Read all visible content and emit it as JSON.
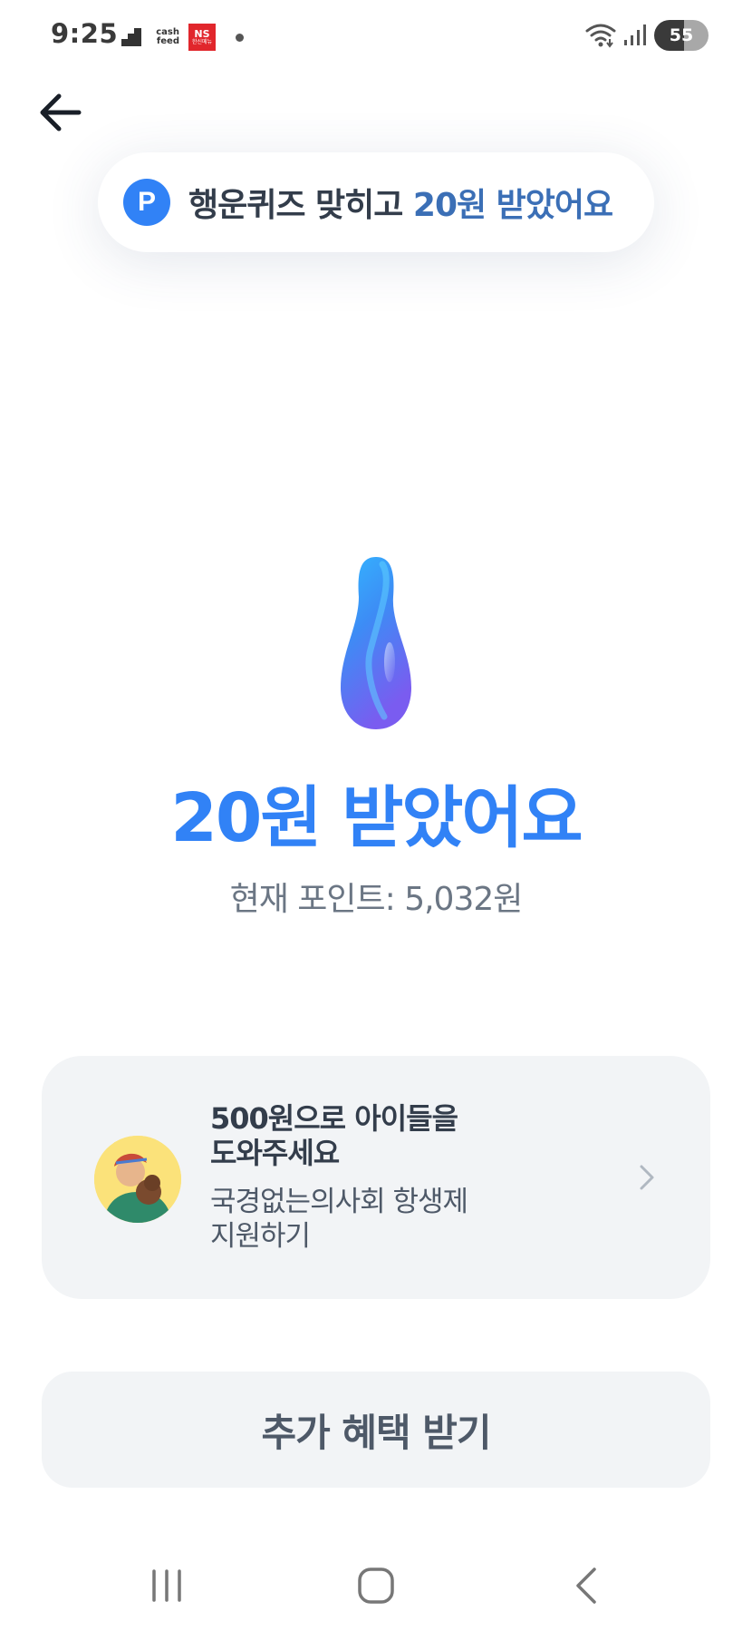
{
  "status_bar": {
    "time": "9:25",
    "notif_cashfeed": "cash feed",
    "notif_ns": "NS",
    "notif_ns_sub": "한신메뉴",
    "battery_level": "55"
  },
  "header": {
    "back_icon": "arrow-left-icon"
  },
  "toast": {
    "icon_letter": "P",
    "text_prefix": "행운퀴즈 맞히고 ",
    "text_highlight": "20원 받았어요"
  },
  "reward": {
    "title": "20원 받았어요",
    "current_points": "현재 포인트: 5,032원"
  },
  "donation_card": {
    "title": "500원으로 아이들을\n도와주세요",
    "description": "국경없는의사회 항생제\n지원하기"
  },
  "extra_button": {
    "label": "추가 혜택 받기"
  },
  "nav": {
    "recents": "recents-icon",
    "home": "home-icon",
    "back": "back-icon"
  },
  "colors": {
    "accent": "#3182f6",
    "card_bg": "#f2f4f6",
    "toast_highlight": "#3b6fb6"
  }
}
